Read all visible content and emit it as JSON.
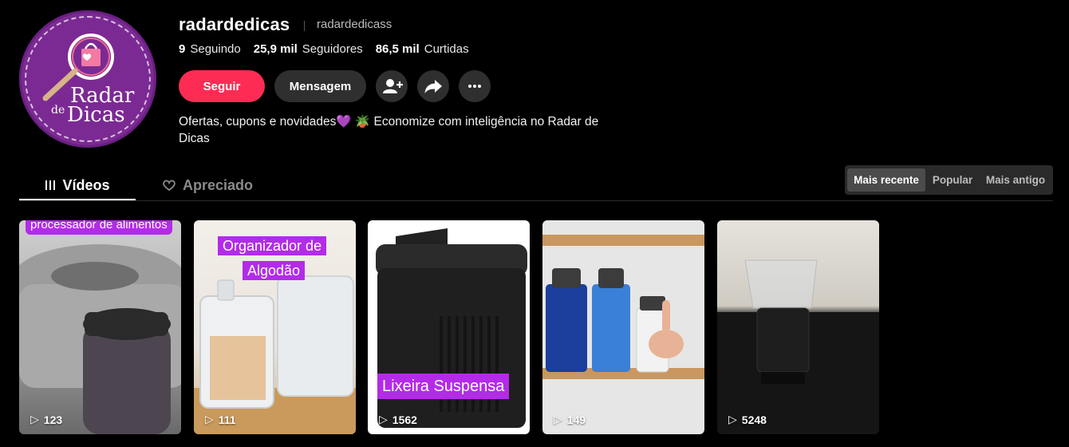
{
  "profile": {
    "username": "radardedicas",
    "handle": "radardedicass",
    "avatar_text": {
      "line1": "Radar",
      "line2": "de",
      "line3": "Dicas"
    },
    "stats": [
      {
        "value": "9",
        "label": "Seguindo"
      },
      {
        "value": "25,9 mil",
        "label": "Seguidores"
      },
      {
        "value": "86,5 mil",
        "label": "Curtidas"
      }
    ],
    "bio_line1": "Ofertas, cupons e novidades💜  🪴  Economize com inteligência no Radar de",
    "bio_line2": "Dicas"
  },
  "actions": {
    "follow_label": "Seguir",
    "message_label": "Mensagem",
    "icons": [
      "add-friend-icon",
      "share-icon",
      "more-icon"
    ]
  },
  "tabs": [
    {
      "label": "Vídeos",
      "icon": "grid-icon",
      "active": true
    },
    {
      "label": "Apreciado",
      "icon": "heart-icon",
      "active": false
    }
  ],
  "sort": {
    "options": [
      "Mais recente",
      "Popular",
      "Mais antigo"
    ],
    "selected": "Mais recente"
  },
  "videos": [
    {
      "caption": "processador de alimentos",
      "views": "123"
    },
    {
      "caption_line1": "Organizador de",
      "caption_line2": "Algodão",
      "views": "111"
    },
    {
      "caption": "Lixeira Suspensa",
      "views": "1562"
    },
    {
      "views": "149"
    },
    {
      "views": "5248"
    }
  ],
  "colors": {
    "accent": "#fe2c55",
    "caption_bg": "#b32be8",
    "avatar_bg": "#7b2a93"
  }
}
